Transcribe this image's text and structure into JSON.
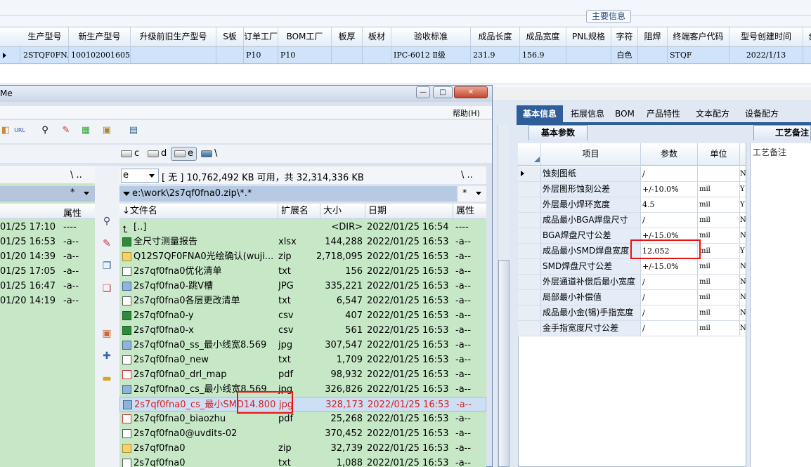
{
  "top_grid": {
    "group_label": "主要信息",
    "columns": [
      "生产型号",
      "新生产型号",
      "升级前旧生产型号",
      "S板",
      "订单工厂",
      "BOM工厂",
      "板厚",
      "板材",
      "验收标准",
      "成品长度",
      "成品宽度",
      "PNL规格",
      "字符",
      "阻焊",
      "终端客户代码",
      "型号创建时间",
      "台"
    ],
    "row": [
      "2STQF0FNA0",
      "10010200160515",
      "",
      "",
      "P10",
      "P10",
      "",
      "",
      "IPC-6012 Ⅱ级",
      "231.9",
      "156.9",
      "",
      "白色",
      "",
      "STQF",
      "",
      "2022/1/13"
    ]
  },
  "file_manager": {
    "title": "Me",
    "menu_help": "帮助(H)",
    "drives": [
      {
        "label": "c"
      },
      {
        "label": "d"
      },
      {
        "label": "e"
      },
      {
        "label": "\\"
      }
    ],
    "left_pane": {
      "nav": "\\  ..",
      "filter": "*",
      "col_attr": "属性",
      "rows": [
        {
          "date": "01/25 17:10",
          "attr": "----"
        },
        {
          "date": "01/25 16:53",
          "attr": "-a--"
        },
        {
          "date": "01/20 14:39",
          "attr": "-a--"
        },
        {
          "date": "01/25 17:05",
          "attr": "-a--"
        },
        {
          "date": "01/25 16:47",
          "attr": "-a--"
        },
        {
          "date": "01/20 14:19",
          "attr": "-a--"
        }
      ]
    },
    "right_pane": {
      "drive": "e",
      "space_info": "[ 无 ]  10,762,492 KB 可用，共 32,314,336 KB",
      "nav": "\\  ..",
      "path": "e:\\work\\2s7qf0fna0.zip\\*.*",
      "filter": "*",
      "columns": {
        "name": "↓文件名",
        "ext": "扩展名",
        "size": "大小",
        "date": "日期",
        "attr": "属性"
      },
      "files": [
        {
          "name": "[..]",
          "ext": "",
          "size": "<DIR>",
          "date": "2022/01/25 16:54",
          "attr": "----",
          "icon": "up-folder-icon"
        },
        {
          "name": "全尺寸测量报告",
          "ext": "xlsx",
          "size": "144,288",
          "date": "2022/01/25 16:53",
          "attr": "-a--",
          "icon": "excel-file-icon"
        },
        {
          "name": "Q12S7QF0FNA0光绘确认(wuji...",
          "ext": "zip",
          "size": "2,718,095",
          "date": "2022/01/25 16:53",
          "attr": "-a--",
          "icon": "zip-file-icon"
        },
        {
          "name": "2s7qf0fna0优化清单",
          "ext": "txt",
          "size": "156",
          "date": "2022/01/25 16:53",
          "attr": "-a--",
          "icon": "text-file-icon"
        },
        {
          "name": "2s7qf0fna0-跳V槽",
          "ext": "JPG",
          "size": "335,221",
          "date": "2022/01/25 16:53",
          "attr": "-a--",
          "icon": "image-file-icon"
        },
        {
          "name": "2s7qf0fna0各层更改清单",
          "ext": "txt",
          "size": "6,547",
          "date": "2022/01/25 16:53",
          "attr": "-a--",
          "icon": "text-file-icon"
        },
        {
          "name": "2s7qf0fna0-y",
          "ext": "csv",
          "size": "407",
          "date": "2022/01/25 16:53",
          "attr": "-a--",
          "icon": "excel-file-icon"
        },
        {
          "name": "2s7qf0fna0-x",
          "ext": "csv",
          "size": "561",
          "date": "2022/01/25 16:53",
          "attr": "-a--",
          "icon": "excel-file-icon"
        },
        {
          "name": "2s7qf0fna0_ss_最小线宽8.569",
          "ext": "jpg",
          "size": "307,547",
          "date": "2022/01/25 16:53",
          "attr": "-a--",
          "icon": "image-file-icon"
        },
        {
          "name": "2s7qf0fna0_new",
          "ext": "txt",
          "size": "1,709",
          "date": "2022/01/25 16:53",
          "attr": "-a--",
          "icon": "text-file-icon"
        },
        {
          "name": "2s7qf0fna0_drl_map",
          "ext": "pdf",
          "size": "98,932",
          "date": "2022/01/25 16:53",
          "attr": "-a--",
          "icon": "pdf-file-icon"
        },
        {
          "name": "2s7qf0fna0_cs_最小线宽8.569",
          "ext": "jpg",
          "size": "326,826",
          "date": "2022/01/25 16:53",
          "attr": "-a--",
          "icon": "image-file-icon"
        },
        {
          "name": "2s7qf0fna0_cs_最小SMD14.800",
          "ext": "jpg",
          "size": "328,173",
          "date": "2022/01/25 16:53",
          "attr": "-a--",
          "icon": "image-file-icon",
          "selected": true
        },
        {
          "name": "2s7qf0fna0_biaozhu",
          "ext": "pdf",
          "size": "25,268",
          "date": "2022/01/25 16:53",
          "attr": "-a--",
          "icon": "pdf-file-icon"
        },
        {
          "name": "2s7qf0fna0@uvdits-02",
          "ext": "",
          "size": "370,452",
          "date": "2022/01/25 16:53",
          "attr": "-a--",
          "icon": "text-file-icon"
        },
        {
          "name": "2s7qf0fna0",
          "ext": "zip",
          "size": "32,739",
          "date": "2022/01/25 16:53",
          "attr": "-a--",
          "icon": "zip-file-icon"
        },
        {
          "name": "2s7qf0fna0",
          "ext": "txt",
          "size": "1,088",
          "date": "2022/01/25 16:53",
          "attr": "-a--",
          "icon": "text-file-icon"
        }
      ]
    }
  },
  "right_panel": {
    "tabs": [
      "基本信息",
      "拓展信息",
      "BOM",
      "产品特性",
      "文本配方",
      "设备配方"
    ],
    "subtab": "基本参数",
    "proc_subtab": "工艺备注",
    "proc_label": "工艺备注",
    "columns": [
      "项目",
      "参数",
      "单位"
    ],
    "rows": [
      {
        "name": "蚀刻图纸",
        "value": "/",
        "unit": "",
        "extra": "N"
      },
      {
        "name": "外层图形蚀刻公差",
        "value": "+/-10.0%",
        "unit": "mil",
        "extra": "Y"
      },
      {
        "name": "外层最小焊环宽度",
        "value": "4.5",
        "unit": "mil",
        "extra": "Y"
      },
      {
        "name": "成品最小BGA焊盘尺寸",
        "value": "/",
        "unit": "mil",
        "extra": "N"
      },
      {
        "name": "BGA焊盘尺寸公差",
        "value": "+/-15.0%",
        "unit": "mil",
        "extra": "N"
      },
      {
        "name": "成品最小SMD焊盘宽度",
        "value": "12.052",
        "unit": "mil",
        "extra": "Y"
      },
      {
        "name": "SMD焊盘尺寸公差",
        "value": "+/-15.0%",
        "unit": "mil",
        "extra": "N"
      },
      {
        "name": "外层通道补偿后最小宽度",
        "value": "/",
        "unit": "mil",
        "extra": "N"
      },
      {
        "name": "局部最小补偿值",
        "value": "/",
        "unit": "mil",
        "extra": "N"
      },
      {
        "name": "成品最小金(锡)手指宽度",
        "value": "/",
        "unit": "mil",
        "extra": "N"
      },
      {
        "name": "金手指宽度尺寸公差",
        "value": "/",
        "unit": "mil",
        "extra": "N"
      }
    ]
  },
  "colors": {
    "accent": "#2f5d9a",
    "file_bg": "#c7e8c7",
    "highlight": "#e11111"
  }
}
